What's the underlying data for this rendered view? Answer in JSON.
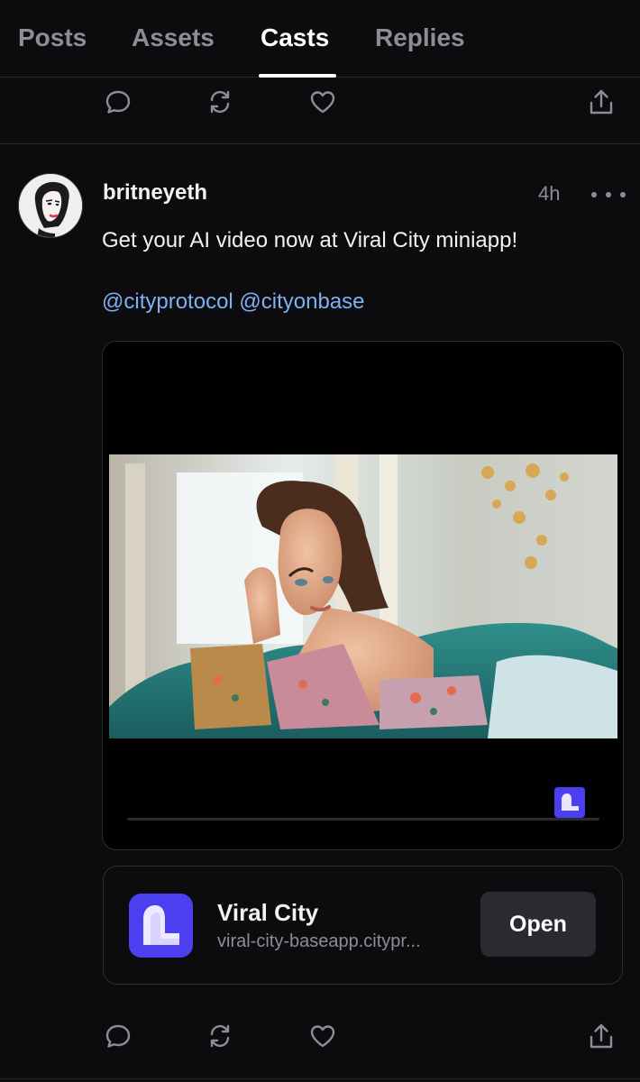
{
  "tabs": [
    {
      "label": "Posts",
      "active": false
    },
    {
      "label": "Assets",
      "active": false
    },
    {
      "label": "Casts",
      "active": true
    },
    {
      "label": "Replies",
      "active": false
    }
  ],
  "action_icons": [
    "reply-icon",
    "recast-icon",
    "like-icon",
    "share-icon"
  ],
  "post": {
    "username": "britneyeth",
    "timestamp": "4h",
    "text": "Get your AI video now at Viral City miniapp!",
    "mentions": [
      "@cityprotocol",
      "@cityonbase"
    ]
  },
  "mini_app": {
    "name": "Viral City",
    "url": "viral-city-baseapp.citypr...",
    "open_label": "Open"
  },
  "colors": {
    "background": "#0c0c0e",
    "mention": "#7fb0f5",
    "brand": "#4b3ff0",
    "muted": "#8d8d96"
  }
}
